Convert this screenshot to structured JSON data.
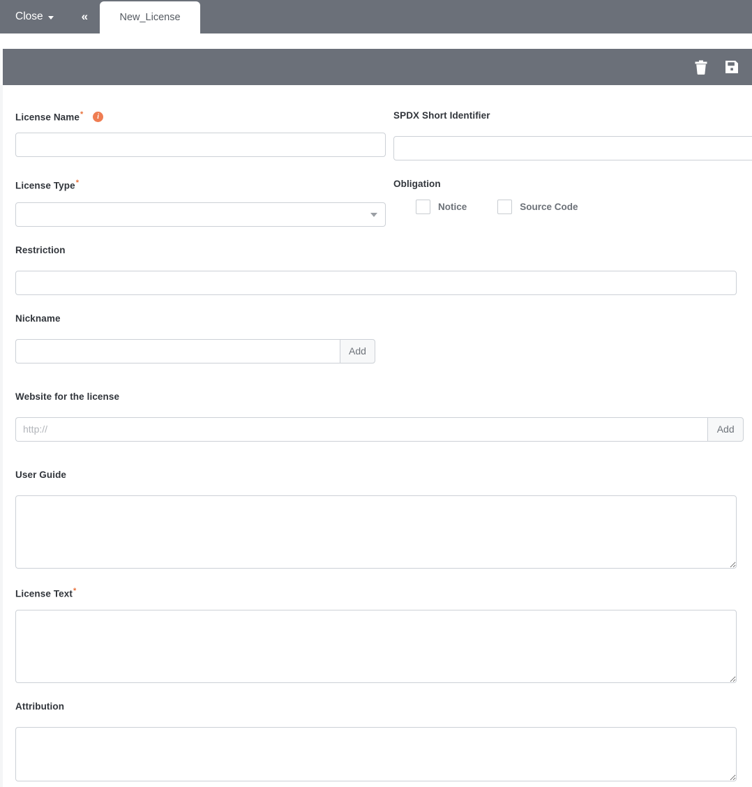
{
  "window": {
    "close_label": "Close",
    "collapse_icon": "double-chevron-left",
    "tab_label": "New_License"
  },
  "toolbar": {
    "delete_icon": "trash-icon",
    "save_icon": "floppy-disk-save-icon"
  },
  "form": {
    "license_name": {
      "label": "License Name",
      "required_marker": "*",
      "info_icon": "info-icon",
      "info_glyph": "i",
      "value": "",
      "placeholder": ""
    },
    "spdx_short_identifier": {
      "label": "SPDX Short Identifier",
      "value": "",
      "placeholder": ""
    },
    "license_type": {
      "label": "License Type",
      "required_marker": "*",
      "selected": "",
      "dropdown_icon": "chevron-down-icon"
    },
    "obligation": {
      "label": "Obligation",
      "options": [
        {
          "label": "Notice",
          "checked": false
        },
        {
          "label": "Source Code",
          "checked": false
        }
      ]
    },
    "restriction": {
      "label": "Restriction",
      "value": "",
      "placeholder": ""
    },
    "nickname": {
      "label": "Nickname",
      "value": "",
      "placeholder": "",
      "add_label": "Add"
    },
    "website": {
      "label": "Website for the license",
      "value": "",
      "placeholder": "http://",
      "add_label": "Add"
    },
    "user_guide": {
      "label": "User Guide",
      "value": "",
      "placeholder": ""
    },
    "license_text": {
      "label": "License Text",
      "required_marker": "*",
      "value": "",
      "placeholder": ""
    },
    "attribution": {
      "label": "Attribution",
      "value": "",
      "placeholder": ""
    }
  },
  "colors": {
    "header_gray": "#6b7079",
    "required_orange": "#e8703a",
    "info_orange": "#ef7d52",
    "border_gray": "#ccd0d6",
    "label_dark": "#31353b"
  }
}
